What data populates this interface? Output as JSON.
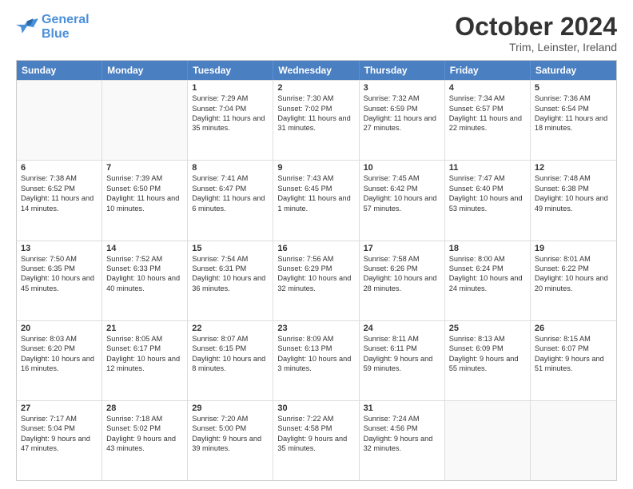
{
  "logo": {
    "line1": "General",
    "line2": "Blue"
  },
  "title": "October 2024",
  "subtitle": "Trim, Leinster, Ireland",
  "header_days": [
    "Sunday",
    "Monday",
    "Tuesday",
    "Wednesday",
    "Thursday",
    "Friday",
    "Saturday"
  ],
  "weeks": [
    [
      {
        "day": "",
        "info": ""
      },
      {
        "day": "",
        "info": ""
      },
      {
        "day": "1",
        "info": "Sunrise: 7:29 AM\nSunset: 7:04 PM\nDaylight: 11 hours and 35 minutes."
      },
      {
        "day": "2",
        "info": "Sunrise: 7:30 AM\nSunset: 7:02 PM\nDaylight: 11 hours and 31 minutes."
      },
      {
        "day": "3",
        "info": "Sunrise: 7:32 AM\nSunset: 6:59 PM\nDaylight: 11 hours and 27 minutes."
      },
      {
        "day": "4",
        "info": "Sunrise: 7:34 AM\nSunset: 6:57 PM\nDaylight: 11 hours and 22 minutes."
      },
      {
        "day": "5",
        "info": "Sunrise: 7:36 AM\nSunset: 6:54 PM\nDaylight: 11 hours and 18 minutes."
      }
    ],
    [
      {
        "day": "6",
        "info": "Sunrise: 7:38 AM\nSunset: 6:52 PM\nDaylight: 11 hours and 14 minutes."
      },
      {
        "day": "7",
        "info": "Sunrise: 7:39 AM\nSunset: 6:50 PM\nDaylight: 11 hours and 10 minutes."
      },
      {
        "day": "8",
        "info": "Sunrise: 7:41 AM\nSunset: 6:47 PM\nDaylight: 11 hours and 6 minutes."
      },
      {
        "day": "9",
        "info": "Sunrise: 7:43 AM\nSunset: 6:45 PM\nDaylight: 11 hours and 1 minute."
      },
      {
        "day": "10",
        "info": "Sunrise: 7:45 AM\nSunset: 6:42 PM\nDaylight: 10 hours and 57 minutes."
      },
      {
        "day": "11",
        "info": "Sunrise: 7:47 AM\nSunset: 6:40 PM\nDaylight: 10 hours and 53 minutes."
      },
      {
        "day": "12",
        "info": "Sunrise: 7:48 AM\nSunset: 6:38 PM\nDaylight: 10 hours and 49 minutes."
      }
    ],
    [
      {
        "day": "13",
        "info": "Sunrise: 7:50 AM\nSunset: 6:35 PM\nDaylight: 10 hours and 45 minutes."
      },
      {
        "day": "14",
        "info": "Sunrise: 7:52 AM\nSunset: 6:33 PM\nDaylight: 10 hours and 40 minutes."
      },
      {
        "day": "15",
        "info": "Sunrise: 7:54 AM\nSunset: 6:31 PM\nDaylight: 10 hours and 36 minutes."
      },
      {
        "day": "16",
        "info": "Sunrise: 7:56 AM\nSunset: 6:29 PM\nDaylight: 10 hours and 32 minutes."
      },
      {
        "day": "17",
        "info": "Sunrise: 7:58 AM\nSunset: 6:26 PM\nDaylight: 10 hours and 28 minutes."
      },
      {
        "day": "18",
        "info": "Sunrise: 8:00 AM\nSunset: 6:24 PM\nDaylight: 10 hours and 24 minutes."
      },
      {
        "day": "19",
        "info": "Sunrise: 8:01 AM\nSunset: 6:22 PM\nDaylight: 10 hours and 20 minutes."
      }
    ],
    [
      {
        "day": "20",
        "info": "Sunrise: 8:03 AM\nSunset: 6:20 PM\nDaylight: 10 hours and 16 minutes."
      },
      {
        "day": "21",
        "info": "Sunrise: 8:05 AM\nSunset: 6:17 PM\nDaylight: 10 hours and 12 minutes."
      },
      {
        "day": "22",
        "info": "Sunrise: 8:07 AM\nSunset: 6:15 PM\nDaylight: 10 hours and 8 minutes."
      },
      {
        "day": "23",
        "info": "Sunrise: 8:09 AM\nSunset: 6:13 PM\nDaylight: 10 hours and 3 minutes."
      },
      {
        "day": "24",
        "info": "Sunrise: 8:11 AM\nSunset: 6:11 PM\nDaylight: 9 hours and 59 minutes."
      },
      {
        "day": "25",
        "info": "Sunrise: 8:13 AM\nSunset: 6:09 PM\nDaylight: 9 hours and 55 minutes."
      },
      {
        "day": "26",
        "info": "Sunrise: 8:15 AM\nSunset: 6:07 PM\nDaylight: 9 hours and 51 minutes."
      }
    ],
    [
      {
        "day": "27",
        "info": "Sunrise: 7:17 AM\nSunset: 5:04 PM\nDaylight: 9 hours and 47 minutes."
      },
      {
        "day": "28",
        "info": "Sunrise: 7:18 AM\nSunset: 5:02 PM\nDaylight: 9 hours and 43 minutes."
      },
      {
        "day": "29",
        "info": "Sunrise: 7:20 AM\nSunset: 5:00 PM\nDaylight: 9 hours and 39 minutes."
      },
      {
        "day": "30",
        "info": "Sunrise: 7:22 AM\nSunset: 4:58 PM\nDaylight: 9 hours and 35 minutes."
      },
      {
        "day": "31",
        "info": "Sunrise: 7:24 AM\nSunset: 4:56 PM\nDaylight: 9 hours and 32 minutes."
      },
      {
        "day": "",
        "info": ""
      },
      {
        "day": "",
        "info": ""
      }
    ]
  ]
}
